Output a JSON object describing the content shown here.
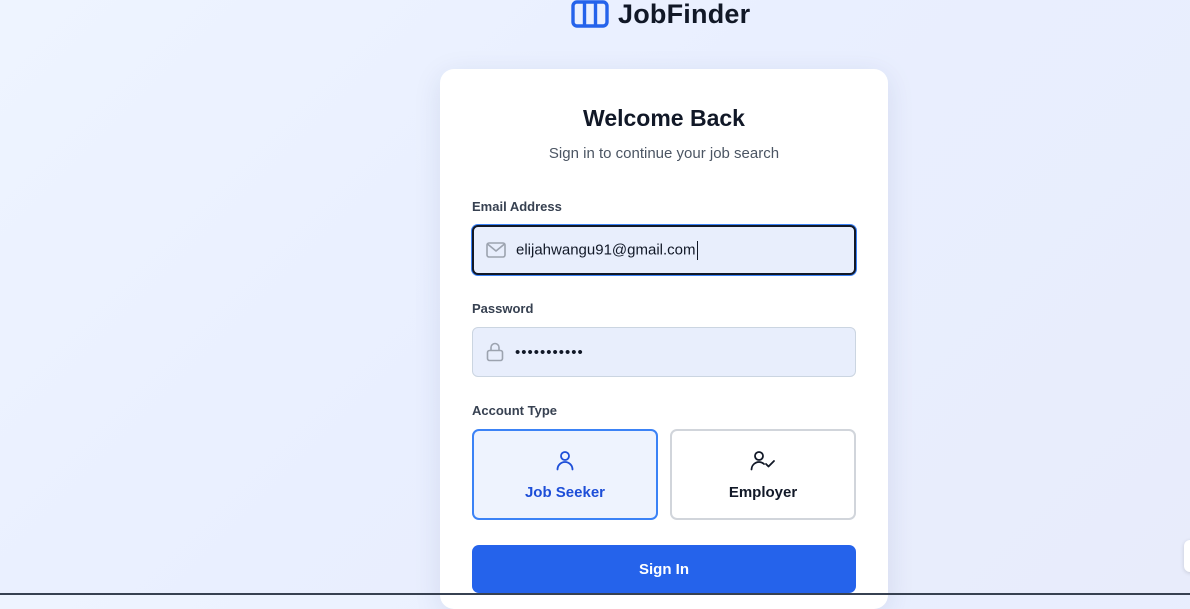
{
  "brand": {
    "name": "JobFinder",
    "icon": "briefcase-columns-icon",
    "color": "#2563eb"
  },
  "login": {
    "title": "Welcome Back",
    "subtitle": "Sign in to continue your job search",
    "email": {
      "label": "Email Address",
      "value": "elijahwangu91@gmail.com",
      "icon": "mail-icon"
    },
    "password": {
      "label": "Password",
      "value": "•••••••••••",
      "icon": "lock-icon"
    },
    "account_type": {
      "label": "Account Type",
      "selected": "Job Seeker",
      "options": [
        {
          "label": "Job Seeker",
          "icon": "user-icon"
        },
        {
          "label": "Employer",
          "icon": "user-check-icon"
        }
      ]
    },
    "submit_label": "Sign In"
  },
  "colors": {
    "accent": "#2563eb",
    "selected_border": "#3b82f6",
    "input_bg": "#e8eefc"
  }
}
